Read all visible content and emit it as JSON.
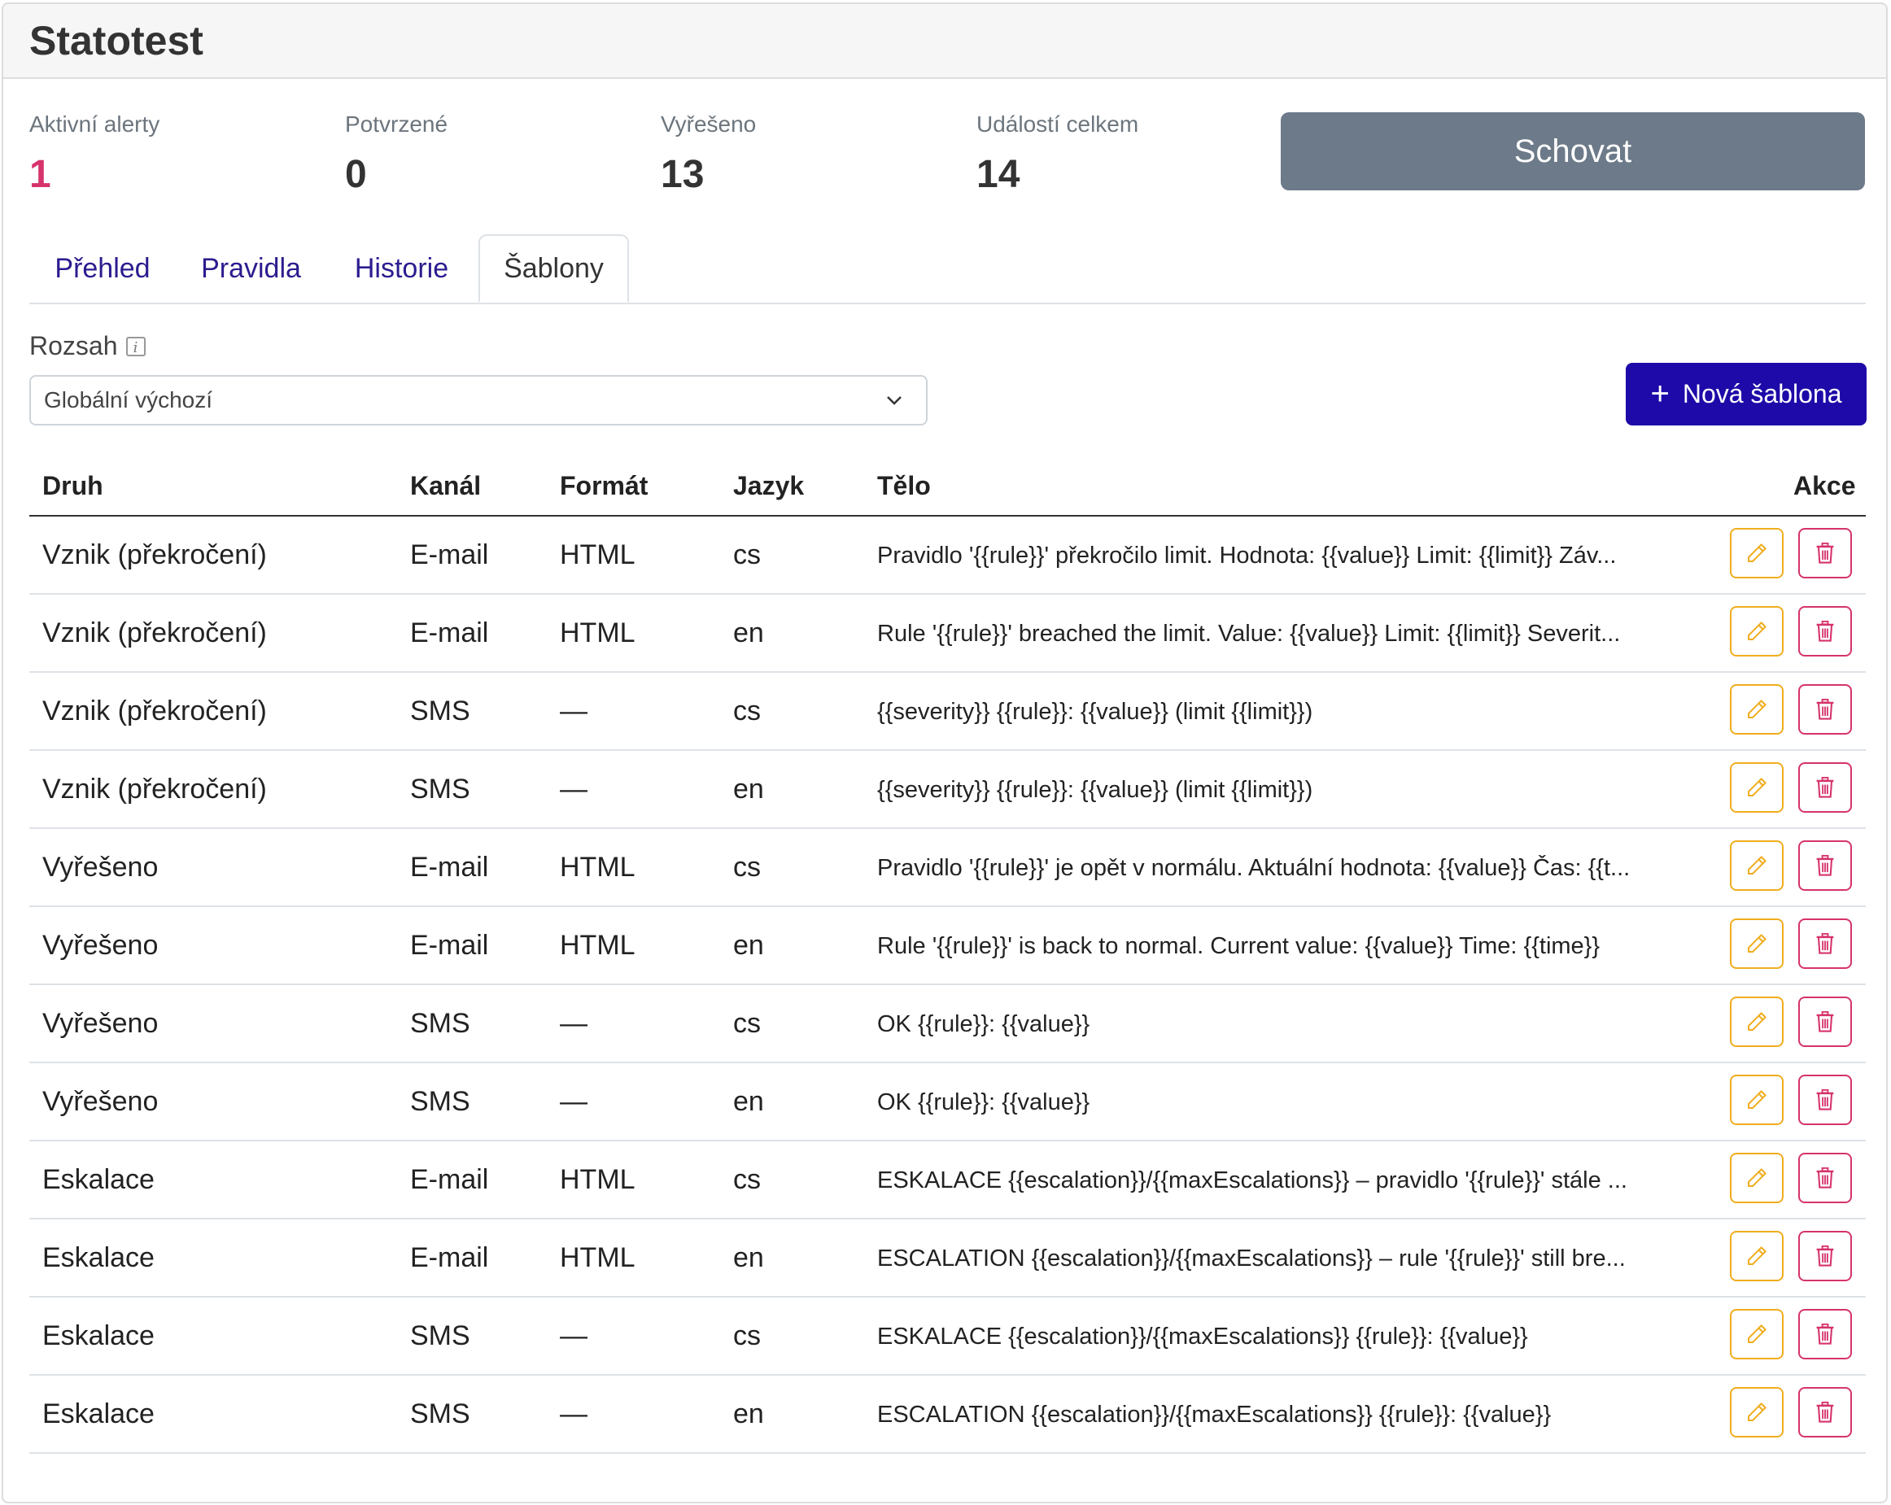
{
  "card": {
    "title": "Statotest"
  },
  "stats": [
    {
      "label": "Aktivní alerty",
      "value": "1"
    },
    {
      "label": "Potvrzené",
      "value": "0"
    },
    {
      "label": "Vyřešeno",
      "value": "13"
    },
    {
      "label": "Událostí celkem",
      "value": "14"
    }
  ],
  "hide_button": "Schovat",
  "tabs": [
    {
      "label": "Přehled"
    },
    {
      "label": "Pravidla"
    },
    {
      "label": "Historie"
    },
    {
      "label": "Šablony",
      "active": true
    }
  ],
  "scope": {
    "label": "Rozsah",
    "selected": "Globální výchozí"
  },
  "new_button": {
    "icon": "plus-icon",
    "label": "Nová šablona"
  },
  "table": {
    "headers": {
      "druh": "Druh",
      "kanal": "Kanál",
      "format": "Formát",
      "jazyk": "Jazyk",
      "telo": "Tělo",
      "akce": "Akce"
    },
    "rows": [
      {
        "druh": "Vznik (překročení)",
        "kanal": "E-mail",
        "format": "HTML",
        "jazyk": "cs",
        "telo": "Pravidlo '{{rule}}' překročilo limit. Hodnota: {{value}} Limit: {{limit}} Záv..."
      },
      {
        "druh": "Vznik (překročení)",
        "kanal": "E-mail",
        "format": "HTML",
        "jazyk": "en",
        "telo": "Rule '{{rule}}' breached the limit. Value: {{value}} Limit: {{limit}} Severit..."
      },
      {
        "druh": "Vznik (překročení)",
        "kanal": "SMS",
        "format": "—",
        "jazyk": "cs",
        "telo": "{{severity}} {{rule}}: {{value}} (limit {{limit}})"
      },
      {
        "druh": "Vznik (překročení)",
        "kanal": "SMS",
        "format": "—",
        "jazyk": "en",
        "telo": "{{severity}} {{rule}}: {{value}} (limit {{limit}})"
      },
      {
        "druh": "Vyřešeno",
        "kanal": "E-mail",
        "format": "HTML",
        "jazyk": "cs",
        "telo": "Pravidlo '{{rule}}' je opět v normálu. Aktuální hodnota: {{value}} Čas: {{t..."
      },
      {
        "druh": "Vyřešeno",
        "kanal": "E-mail",
        "format": "HTML",
        "jazyk": "en",
        "telo": "Rule '{{rule}}' is back to normal. Current value: {{value}} Time: {{time}}"
      },
      {
        "druh": "Vyřešeno",
        "kanal": "SMS",
        "format": "—",
        "jazyk": "cs",
        "telo": "OK {{rule}}: {{value}}"
      },
      {
        "druh": "Vyřešeno",
        "kanal": "SMS",
        "format": "—",
        "jazyk": "en",
        "telo": "OK {{rule}}: {{value}}"
      },
      {
        "druh": "Eskalace",
        "kanal": "E-mail",
        "format": "HTML",
        "jazyk": "cs",
        "telo": "ESKALACE {{escalation}}/{{maxEscalations}} – pravidlo '{{rule}}' stále ..."
      },
      {
        "druh": "Eskalace",
        "kanal": "E-mail",
        "format": "HTML",
        "jazyk": "en",
        "telo": "ESCALATION {{escalation}}/{{maxEscalations}} – rule '{{rule}}' still bre..."
      },
      {
        "druh": "Eskalace",
        "kanal": "SMS",
        "format": "—",
        "jazyk": "cs",
        "telo": "ESKALACE {{escalation}}/{{maxEscalations}} {{rule}}: {{value}}"
      },
      {
        "druh": "Eskalace",
        "kanal": "SMS",
        "format": "—",
        "jazyk": "en",
        "telo": "ESCALATION {{escalation}}/{{maxEscalations}} {{rule}}: {{value}}"
      }
    ]
  },
  "colors": {
    "accent": "#1d0aa8",
    "danger": "#d6336c",
    "warning": "#f0ad1e",
    "secondary": "#6c7a89"
  }
}
